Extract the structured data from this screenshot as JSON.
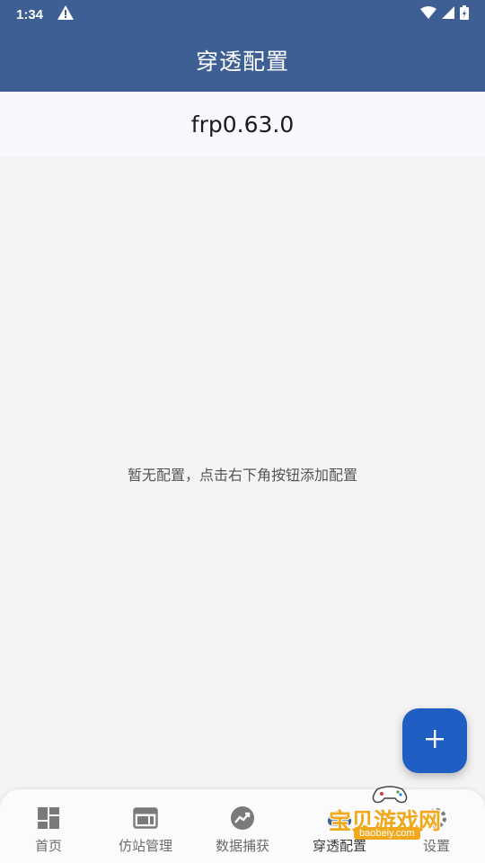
{
  "status_bar": {
    "time": "1:34",
    "icons": [
      "warning-icon",
      "wifi-icon",
      "signal-icon",
      "battery-icon"
    ]
  },
  "app_bar": {
    "title": "穿透配置"
  },
  "version": {
    "text": "frp0.63.0"
  },
  "content": {
    "empty_message": "暂无配置，点击右下角按钮添加配置"
  },
  "fab": {
    "icon": "plus-icon"
  },
  "bottom_nav": {
    "items": [
      {
        "label": "首页",
        "icon": "dashboard-icon"
      },
      {
        "label": "仿站管理",
        "icon": "web-window-icon"
      },
      {
        "label": "数据捕获",
        "icon": "trending-icon"
      },
      {
        "label": "穿透配置",
        "icon": "cloud-icon",
        "active": true
      },
      {
        "label": "设置",
        "icon": "settings-icon"
      }
    ]
  },
  "watermark": {
    "title": "宝贝游戏网",
    "url": "baobeiy.com"
  },
  "colors": {
    "primary": "#3e5f94",
    "fab": "#1f5fc4",
    "background": "#f4f4f4",
    "watermark": "#f0a81c"
  }
}
